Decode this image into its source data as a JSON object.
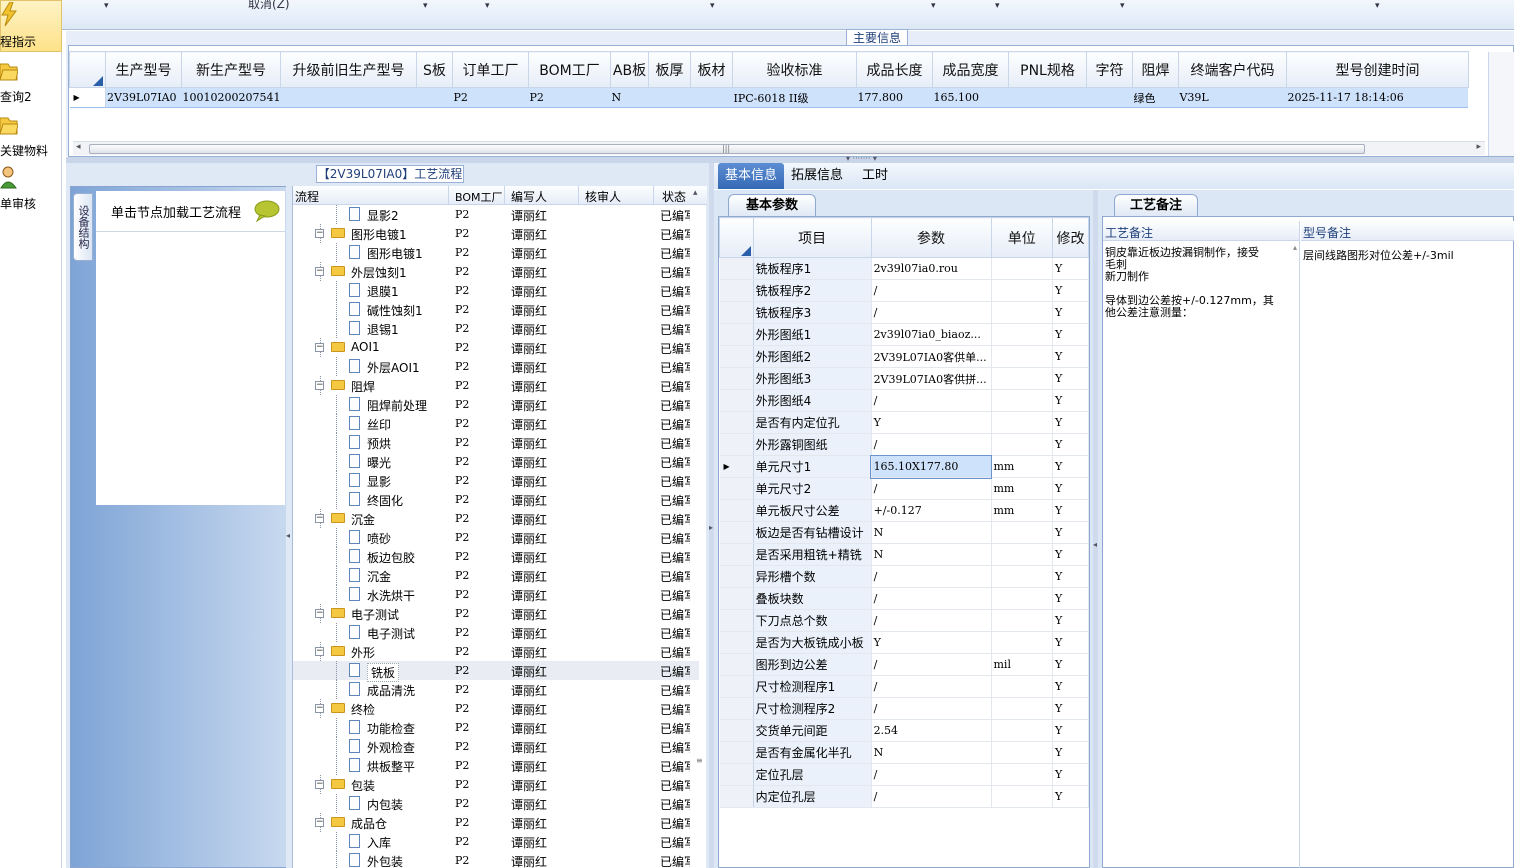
{
  "leftnav": {
    "items": [
      {
        "label": "程指示",
        "icon": "lightning-icon"
      },
      {
        "label": "查询2",
        "icon": "folder-icon"
      },
      {
        "label": "关键物料",
        "icon": "folder-icon"
      },
      {
        "label": "单审核",
        "icon": "user-icon"
      }
    ]
  },
  "topstrip": {
    "cancel_label": "取消(Z)"
  },
  "main_info": {
    "title": "主要信息",
    "columns": [
      "生产型号",
      "新生产型号",
      "升级前旧生产型号",
      "S板",
      "订单工厂",
      "BOM工厂",
      "AB板",
      "板厚",
      "板材",
      "验收标准",
      "成品长度",
      "成品宽度",
      "PNL规格",
      "字符",
      "阻焊",
      "终端客户代码",
      "型号创建时间"
    ],
    "row": [
      "2V39L07IA0",
      "10010200207541",
      "",
      "",
      "P2",
      "P2",
      "N",
      "",
      "",
      "IPC-6018 II级",
      "177.800",
      "165.100",
      "",
      "",
      "绿色",
      "V39L",
      "2025-11-17 18:14:06"
    ]
  },
  "process": {
    "title": "【2V39L07IA0】工艺流程",
    "vertical_tab": "设备结构",
    "load_tab": "单击节点加载工艺流程",
    "columns": [
      "流程",
      "BOM工厂",
      "编写人",
      "核审人",
      "状态"
    ],
    "rows": [
      {
        "name": "显影2",
        "level": 2,
        "type": "doc",
        "factory": "P2",
        "writer": "谭丽红",
        "status": "已编写"
      },
      {
        "name": "图形电镀1",
        "level": 1,
        "type": "folder",
        "factory": "P2",
        "writer": "谭丽红",
        "status": "已编写"
      },
      {
        "name": "图形电镀1",
        "level": 2,
        "type": "doc",
        "factory": "P2",
        "writer": "谭丽红",
        "status": "已编写"
      },
      {
        "name": "外层蚀刻1",
        "level": 1,
        "type": "folder",
        "factory": "P2",
        "writer": "谭丽红",
        "status": "已编写"
      },
      {
        "name": "退膜1",
        "level": 2,
        "type": "doc",
        "factory": "P2",
        "writer": "谭丽红",
        "status": "已编写"
      },
      {
        "name": "碱性蚀刻1",
        "level": 2,
        "type": "doc",
        "factory": "P2",
        "writer": "谭丽红",
        "status": "已编写"
      },
      {
        "name": "退锡1",
        "level": 2,
        "type": "doc",
        "factory": "P2",
        "writer": "谭丽红",
        "status": "已编写"
      },
      {
        "name": "AOI1",
        "level": 1,
        "type": "folder",
        "factory": "P2",
        "writer": "谭丽红",
        "status": "已编写"
      },
      {
        "name": "外层AOI1",
        "level": 2,
        "type": "doc",
        "factory": "P2",
        "writer": "谭丽红",
        "status": "已编写"
      },
      {
        "name": "阻焊",
        "level": 1,
        "type": "folder",
        "factory": "P2",
        "writer": "谭丽红",
        "status": "已编写"
      },
      {
        "name": "阻焊前处理",
        "level": 2,
        "type": "doc",
        "factory": "P2",
        "writer": "谭丽红",
        "status": "已编写"
      },
      {
        "name": "丝印",
        "level": 2,
        "type": "doc",
        "factory": "P2",
        "writer": "谭丽红",
        "status": "已编写"
      },
      {
        "name": "预烘",
        "level": 2,
        "type": "doc",
        "factory": "P2",
        "writer": "谭丽红",
        "status": "已编写"
      },
      {
        "name": "曝光",
        "level": 2,
        "type": "doc",
        "factory": "P2",
        "writer": "谭丽红",
        "status": "已编写"
      },
      {
        "name": "显影",
        "level": 2,
        "type": "doc",
        "factory": "P2",
        "writer": "谭丽红",
        "status": "已编写"
      },
      {
        "name": "终固化",
        "level": 2,
        "type": "doc",
        "factory": "P2",
        "writer": "谭丽红",
        "status": "已编写"
      },
      {
        "name": "沉金",
        "level": 1,
        "type": "folder",
        "factory": "P2",
        "writer": "谭丽红",
        "status": "已编写"
      },
      {
        "name": "喷砂",
        "level": 2,
        "type": "doc",
        "factory": "P2",
        "writer": "谭丽红",
        "status": "已编写"
      },
      {
        "name": "板边包胶",
        "level": 2,
        "type": "doc",
        "factory": "P2",
        "writer": "谭丽红",
        "status": "已编写"
      },
      {
        "name": "沉金",
        "level": 2,
        "type": "doc",
        "factory": "P2",
        "writer": "谭丽红",
        "status": "已编写"
      },
      {
        "name": "水洗烘干",
        "level": 2,
        "type": "doc",
        "factory": "P2",
        "writer": "谭丽红",
        "status": "已编写"
      },
      {
        "name": "电子测试",
        "level": 1,
        "type": "folder",
        "factory": "P2",
        "writer": "谭丽红",
        "status": "已编写"
      },
      {
        "name": "电子测试",
        "level": 2,
        "type": "doc",
        "factory": "P2",
        "writer": "谭丽红",
        "status": "已编写"
      },
      {
        "name": "外形",
        "level": 1,
        "type": "folder",
        "factory": "P2",
        "writer": "谭丽红",
        "status": "已编写"
      },
      {
        "name": "铣板",
        "level": 2,
        "type": "doc",
        "factory": "P2",
        "writer": "谭丽红",
        "status": "已编写",
        "selected": true
      },
      {
        "name": "成品清洗",
        "level": 2,
        "type": "doc",
        "factory": "P2",
        "writer": "谭丽红",
        "status": "已编写"
      },
      {
        "name": "终检",
        "level": 1,
        "type": "folder",
        "factory": "P2",
        "writer": "谭丽红",
        "status": "已编写"
      },
      {
        "name": "功能检查",
        "level": 2,
        "type": "doc",
        "factory": "P2",
        "writer": "谭丽红",
        "status": "已编写"
      },
      {
        "name": "外观检查",
        "level": 2,
        "type": "doc",
        "factory": "P2",
        "writer": "谭丽红",
        "status": "已编写"
      },
      {
        "name": "烘板整平",
        "level": 2,
        "type": "doc",
        "factory": "P2",
        "writer": "谭丽红",
        "status": "已编写"
      },
      {
        "name": "包装",
        "level": 1,
        "type": "folder",
        "factory": "P2",
        "writer": "谭丽红",
        "status": "已编写"
      },
      {
        "name": "内包装",
        "level": 2,
        "type": "doc",
        "factory": "P2",
        "writer": "谭丽红",
        "status": "已编写"
      },
      {
        "name": "成品仓",
        "level": 1,
        "type": "folder",
        "factory": "P2",
        "writer": "谭丽红",
        "status": "已编写"
      },
      {
        "name": "入库",
        "level": 2,
        "type": "doc",
        "factory": "P2",
        "writer": "谭丽红",
        "status": "已编写"
      },
      {
        "name": "外包装",
        "level": 2,
        "type": "doc",
        "factory": "P2",
        "writer": "谭丽红",
        "status": "已编写"
      }
    ]
  },
  "detail": {
    "tabs": [
      "基本信息",
      "拓展信息",
      "工时"
    ],
    "subtab": "基本参数",
    "columns": [
      "项目",
      "参数",
      "单位",
      "修改"
    ],
    "rows": [
      [
        "铣板程序1",
        "2v39l07ia0.rou",
        "",
        "Y"
      ],
      [
        "铣板程序2",
        "/",
        "",
        "Y"
      ],
      [
        "铣板程序3",
        "/",
        "",
        "Y"
      ],
      [
        "外形图纸1",
        "2v39l07ia0_biaoz...",
        "",
        "Y"
      ],
      [
        "外形图纸2",
        "2V39L07IA0客供单...",
        "",
        "Y"
      ],
      [
        "外形图纸3",
        "2V39L07IA0客供拼...",
        "",
        "Y"
      ],
      [
        "外形图纸4",
        "/",
        "",
        "Y"
      ],
      [
        "是否有内定位孔",
        "Y",
        "",
        "Y"
      ],
      [
        "外形露铜图纸",
        "/",
        "",
        "Y"
      ],
      [
        "单元尺寸1",
        "165.10X177.80",
        "mm",
        "Y"
      ],
      [
        "单元尺寸2",
        "/",
        "mm",
        "Y"
      ],
      [
        "单元板尺寸公差",
        "+/-0.127",
        "mm",
        "Y"
      ],
      [
        "板边是否有钻槽设计",
        "N",
        "",
        "Y"
      ],
      [
        "是否采用粗铣+精铣",
        "N",
        "",
        "Y"
      ],
      [
        "异形槽个数",
        "/",
        "",
        "Y"
      ],
      [
        "叠板块数",
        "/",
        "",
        "Y"
      ],
      [
        "下刀点总个数",
        "/",
        "",
        "Y"
      ],
      [
        "是否为大板铣成小板",
        "Y",
        "",
        "Y"
      ],
      [
        "图形到边公差",
        "/",
        "mil",
        "Y"
      ],
      [
        "尺寸检测程序1",
        "/",
        "",
        "Y"
      ],
      [
        "尺寸检测程序2",
        "/",
        "",
        "Y"
      ],
      [
        "交货单元间距",
        "2.54",
        "",
        "Y"
      ],
      [
        "是否有金属化半孔",
        "N",
        "",
        "Y"
      ],
      [
        "定位孔层",
        "/",
        "",
        "Y"
      ],
      [
        "内定位孔层",
        "/",
        "",
        "Y"
      ]
    ],
    "selected_row": 9
  },
  "notes": {
    "tab": "工艺备注",
    "col1_title": "工艺备注",
    "col2_title": "型号备注",
    "note_lines": [
      "铜皮靠近板边按漏铜制作，接受",
      "毛刺",
      "新刀制作",
      "",
      "导体到边公差按+/-0.127mm，其",
      "他公差注意测量："
    ],
    "model_note": "层间线路图形对位公差+/-3mil"
  }
}
